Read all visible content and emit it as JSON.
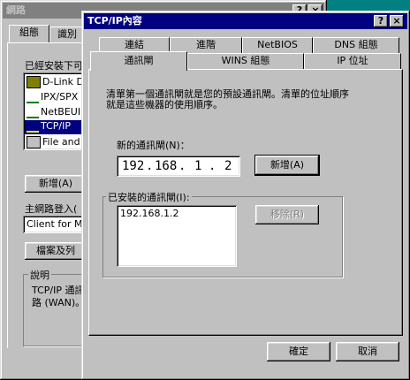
{
  "network_window": {
    "title": "網路",
    "tabs": [
      "組態",
      "識別"
    ],
    "installed_label": "已經安裝下可",
    "components": [
      {
        "label": "D-Link D",
        "icon": "network-adapter-icon"
      },
      {
        "label": "IPX/SPX",
        "icon": "protocol-icon"
      },
      {
        "label": "NetBEUI",
        "icon": "protocol-icon"
      },
      {
        "label": "TCP/IP",
        "icon": "protocol-icon"
      },
      {
        "label": "File and p",
        "icon": "service-icon"
      }
    ],
    "add_button": "新增(A)",
    "primary_logon_label": "主網路登入(",
    "primary_logon_value": "Client for Mi",
    "file_sharing_button": "檔案及列",
    "description_label": "說明",
    "description_text_1": "TCP/IP 通訊",
    "description_text_2": "路 (WAN)。"
  },
  "tcpip_dialog": {
    "title": "TCP/IP內容",
    "help_btn": "?",
    "close_btn": "×",
    "tabs_row1": [
      "連結",
      "進階",
      "NetBIOS",
      "DNS 組態"
    ],
    "tabs_row2": [
      "通訊閘",
      "WINS 組態",
      "IP 位址"
    ],
    "active_tab": "通訊閘",
    "info_line1": "清單第一個通訊閘就是您的預設通訊閘。清單的位址順序",
    "info_line2": "就是這些機器的使用順序。",
    "new_gateway_label": "新的通訊閘(N)：",
    "ip": {
      "o1": "192",
      "o2": "168",
      "o3": "1",
      "o4": "2",
      "sep": "."
    },
    "add_button": "新增(A)",
    "installed_group_label": "已安裝的通訊閘(I):",
    "installed_gateways": [
      "192.168.1.2"
    ],
    "remove_button": "移除(R)",
    "ok_button": "確定",
    "cancel_button": "取消"
  },
  "colors": {
    "titlebar_active": "#000080",
    "titlebar_inactive": "#808080",
    "face": "#c0c0c0",
    "desktop": "#008080"
  }
}
